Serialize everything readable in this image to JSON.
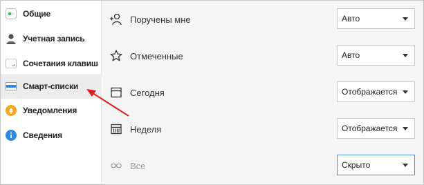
{
  "sidebar": {
    "items": [
      {
        "label": "Общие",
        "icon": "toggle-icon"
      },
      {
        "label": "Учетная запись",
        "icon": "user-icon"
      },
      {
        "label": "Сочетания клавиш",
        "icon": "keyboard-icon"
      },
      {
        "label": "Смарт-списки",
        "icon": "smart-list-icon",
        "active": true
      },
      {
        "label": "Уведомления",
        "icon": "bell-icon"
      },
      {
        "label": "Сведения",
        "icon": "info-icon"
      }
    ]
  },
  "settings": {
    "rows": [
      {
        "label": "Поручены мне",
        "icon": "assigned-user-icon",
        "value": "Авто"
      },
      {
        "label": "Отмеченные",
        "icon": "star-icon",
        "value": "Авто"
      },
      {
        "label": "Сегодня",
        "icon": "calendar-today-icon",
        "value": "Отображается"
      },
      {
        "label": "Неделя",
        "icon": "calendar-week-icon",
        "value": "Отображается"
      },
      {
        "label": "Все",
        "icon": "infinity-icon",
        "value": "Скрыто"
      }
    ]
  },
  "colors": {
    "active_item_bg": "#ececec",
    "annotation_arrow": "#e02020",
    "toggle_green": "#3cba54",
    "bell_orange": "#f5a623",
    "info_blue": "#2d8ae0",
    "focus_border": "#4a90d9"
  }
}
